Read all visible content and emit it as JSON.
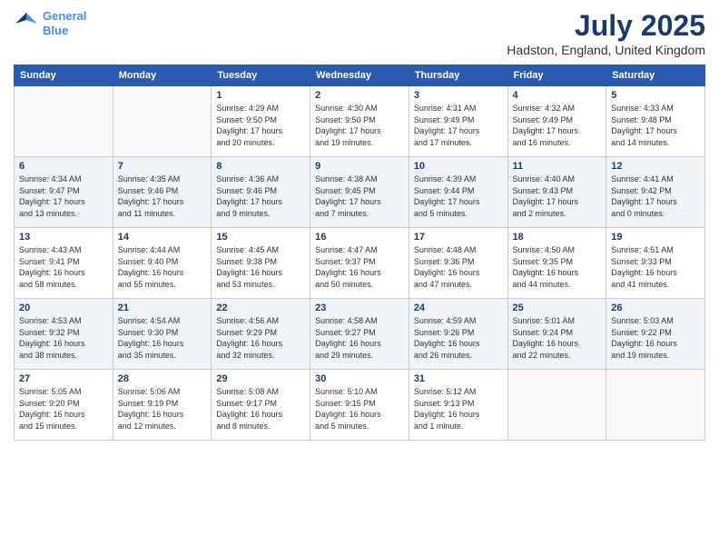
{
  "header": {
    "logo_line1": "General",
    "logo_line2": "Blue",
    "title": "July 2025",
    "subtitle": "Hadston, England, United Kingdom"
  },
  "days_of_week": [
    "Sunday",
    "Monday",
    "Tuesday",
    "Wednesday",
    "Thursday",
    "Friday",
    "Saturday"
  ],
  "weeks": [
    [
      {
        "day": "",
        "info": ""
      },
      {
        "day": "",
        "info": ""
      },
      {
        "day": "1",
        "info": "Sunrise: 4:29 AM\nSunset: 9:50 PM\nDaylight: 17 hours\nand 20 minutes."
      },
      {
        "day": "2",
        "info": "Sunrise: 4:30 AM\nSunset: 9:50 PM\nDaylight: 17 hours\nand 19 minutes."
      },
      {
        "day": "3",
        "info": "Sunrise: 4:31 AM\nSunset: 9:49 PM\nDaylight: 17 hours\nand 17 minutes."
      },
      {
        "day": "4",
        "info": "Sunrise: 4:32 AM\nSunset: 9:49 PM\nDaylight: 17 hours\nand 16 minutes."
      },
      {
        "day": "5",
        "info": "Sunrise: 4:33 AM\nSunset: 9:48 PM\nDaylight: 17 hours\nand 14 minutes."
      }
    ],
    [
      {
        "day": "6",
        "info": "Sunrise: 4:34 AM\nSunset: 9:47 PM\nDaylight: 17 hours\nand 13 minutes."
      },
      {
        "day": "7",
        "info": "Sunrise: 4:35 AM\nSunset: 9:46 PM\nDaylight: 17 hours\nand 11 minutes."
      },
      {
        "day": "8",
        "info": "Sunrise: 4:36 AM\nSunset: 9:46 PM\nDaylight: 17 hours\nand 9 minutes."
      },
      {
        "day": "9",
        "info": "Sunrise: 4:38 AM\nSunset: 9:45 PM\nDaylight: 17 hours\nand 7 minutes."
      },
      {
        "day": "10",
        "info": "Sunrise: 4:39 AM\nSunset: 9:44 PM\nDaylight: 17 hours\nand 5 minutes."
      },
      {
        "day": "11",
        "info": "Sunrise: 4:40 AM\nSunset: 9:43 PM\nDaylight: 17 hours\nand 2 minutes."
      },
      {
        "day": "12",
        "info": "Sunrise: 4:41 AM\nSunset: 9:42 PM\nDaylight: 17 hours\nand 0 minutes."
      }
    ],
    [
      {
        "day": "13",
        "info": "Sunrise: 4:43 AM\nSunset: 9:41 PM\nDaylight: 16 hours\nand 58 minutes."
      },
      {
        "day": "14",
        "info": "Sunrise: 4:44 AM\nSunset: 9:40 PM\nDaylight: 16 hours\nand 55 minutes."
      },
      {
        "day": "15",
        "info": "Sunrise: 4:45 AM\nSunset: 9:38 PM\nDaylight: 16 hours\nand 53 minutes."
      },
      {
        "day": "16",
        "info": "Sunrise: 4:47 AM\nSunset: 9:37 PM\nDaylight: 16 hours\nand 50 minutes."
      },
      {
        "day": "17",
        "info": "Sunrise: 4:48 AM\nSunset: 9:36 PM\nDaylight: 16 hours\nand 47 minutes."
      },
      {
        "day": "18",
        "info": "Sunrise: 4:50 AM\nSunset: 9:35 PM\nDaylight: 16 hours\nand 44 minutes."
      },
      {
        "day": "19",
        "info": "Sunrise: 4:51 AM\nSunset: 9:33 PM\nDaylight: 16 hours\nand 41 minutes."
      }
    ],
    [
      {
        "day": "20",
        "info": "Sunrise: 4:53 AM\nSunset: 9:32 PM\nDaylight: 16 hours\nand 38 minutes."
      },
      {
        "day": "21",
        "info": "Sunrise: 4:54 AM\nSunset: 9:30 PM\nDaylight: 16 hours\nand 35 minutes."
      },
      {
        "day": "22",
        "info": "Sunrise: 4:56 AM\nSunset: 9:29 PM\nDaylight: 16 hours\nand 32 minutes."
      },
      {
        "day": "23",
        "info": "Sunrise: 4:58 AM\nSunset: 9:27 PM\nDaylight: 16 hours\nand 29 minutes."
      },
      {
        "day": "24",
        "info": "Sunrise: 4:59 AM\nSunset: 9:26 PM\nDaylight: 16 hours\nand 26 minutes."
      },
      {
        "day": "25",
        "info": "Sunrise: 5:01 AM\nSunset: 9:24 PM\nDaylight: 16 hours\nand 22 minutes."
      },
      {
        "day": "26",
        "info": "Sunrise: 5:03 AM\nSunset: 9:22 PM\nDaylight: 16 hours\nand 19 minutes."
      }
    ],
    [
      {
        "day": "27",
        "info": "Sunrise: 5:05 AM\nSunset: 9:20 PM\nDaylight: 16 hours\nand 15 minutes."
      },
      {
        "day": "28",
        "info": "Sunrise: 5:06 AM\nSunset: 9:19 PM\nDaylight: 16 hours\nand 12 minutes."
      },
      {
        "day": "29",
        "info": "Sunrise: 5:08 AM\nSunset: 9:17 PM\nDaylight: 16 hours\nand 8 minutes."
      },
      {
        "day": "30",
        "info": "Sunrise: 5:10 AM\nSunset: 9:15 PM\nDaylight: 16 hours\nand 5 minutes."
      },
      {
        "day": "31",
        "info": "Sunrise: 5:12 AM\nSunset: 9:13 PM\nDaylight: 16 hours\nand 1 minute."
      },
      {
        "day": "",
        "info": ""
      },
      {
        "day": "",
        "info": ""
      }
    ]
  ]
}
